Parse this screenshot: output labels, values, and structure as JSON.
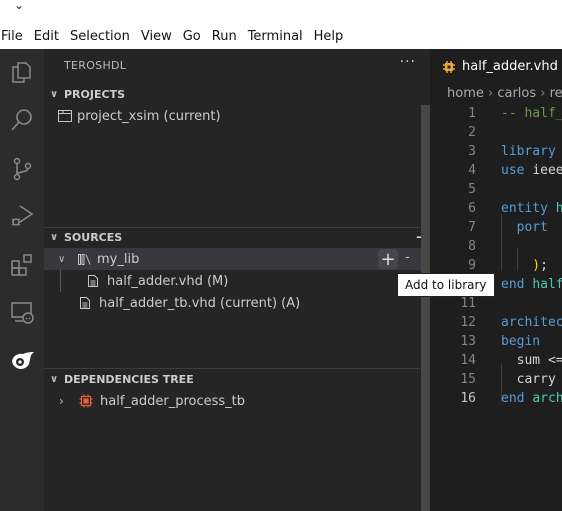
{
  "window": {
    "title_chevron": "⌄"
  },
  "menubar": {
    "items": [
      "File",
      "Edit",
      "Selection",
      "View",
      "Go",
      "Run",
      "Terminal",
      "Help"
    ]
  },
  "activity_bar": {
    "items": [
      "explorer-icon",
      "search-icon",
      "source-control-icon",
      "run-debug-icon",
      "extensions-icon",
      "remote-explorer-icon",
      "teroshdl-icon"
    ]
  },
  "sidebar": {
    "title": "TEROSHDL",
    "more": "···",
    "projects": {
      "header": "PROJECTS",
      "items": [
        {
          "label": "project_xsim (current)",
          "icon": "folder-icon"
        }
      ]
    },
    "sources": {
      "header": "SOURCES",
      "add_label": "+",
      "library": {
        "label": "my_lib",
        "add": "+",
        "remove": "-"
      },
      "items": [
        {
          "label": "half_adder.vhd (M)",
          "icon": "file-icon"
        },
        {
          "label": "half_adder_tb.vhd (current) (A)",
          "icon": "file-icon"
        }
      ]
    },
    "dependencies": {
      "header": "DEPENDENCIES TREE",
      "items": [
        {
          "label": "half_adder_process_tb",
          "icon": "chip-icon"
        }
      ]
    }
  },
  "tooltip": {
    "text": "Add to library"
  },
  "editor": {
    "tab": {
      "label": "half_adder.vhd"
    },
    "breadcrumb": [
      "home",
      "carlos",
      "re"
    ],
    "current_line": 16,
    "lines": [
      {
        "n": "1",
        "tokens": [
          {
            "t": "-- half_",
            "c": "cm"
          }
        ]
      },
      {
        "n": "2",
        "tokens": []
      },
      {
        "n": "3",
        "tokens": [
          {
            "t": "library ",
            "c": "kw"
          }
        ]
      },
      {
        "n": "4",
        "tokens": [
          {
            "t": "use ",
            "c": "kw"
          },
          {
            "t": "ieee",
            "c": "id"
          }
        ]
      },
      {
        "n": "5",
        "tokens": []
      },
      {
        "n": "6",
        "tokens": [
          {
            "t": "entity ",
            "c": "kw"
          },
          {
            "t": "h",
            "c": "ty"
          }
        ]
      },
      {
        "n": "7",
        "tokens": [
          {
            "t": "  port",
            "c": "kw"
          }
        ]
      },
      {
        "n": "8",
        "tokens": []
      },
      {
        "n": "9",
        "tokens": [
          {
            "t": "    )",
            "c": "br"
          },
          {
            "t": ";",
            "c": "id"
          }
        ]
      },
      {
        "n": "10",
        "tokens": [
          {
            "t": "end ",
            "c": "kw"
          },
          {
            "t": "half",
            "c": "ty"
          }
        ]
      },
      {
        "n": "11",
        "tokens": []
      },
      {
        "n": "12",
        "tokens": [
          {
            "t": "architec",
            "c": "kw"
          }
        ]
      },
      {
        "n": "13",
        "tokens": [
          {
            "t": "begin",
            "c": "kw"
          }
        ]
      },
      {
        "n": "14",
        "tokens": [
          {
            "t": "  sum <=",
            "c": "id"
          }
        ]
      },
      {
        "n": "15",
        "tokens": [
          {
            "t": "  carry",
            "c": "id"
          }
        ]
      },
      {
        "n": "16",
        "tokens": [
          {
            "t": "end ",
            "c": "kw"
          },
          {
            "t": "arch",
            "c": "ty"
          }
        ]
      }
    ]
  }
}
